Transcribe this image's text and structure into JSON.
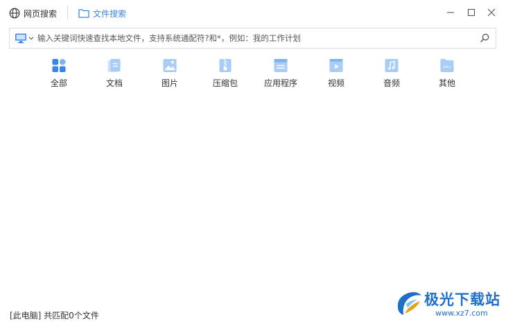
{
  "tabs": {
    "web_search": "网页搜索",
    "file_search": "文件搜索"
  },
  "window_controls": {
    "minimize": "minimize-icon",
    "maximize": "maximize-icon",
    "close": "close-icon"
  },
  "search": {
    "scope_icon": "monitor-icon",
    "placeholder": "输入关键词快速查找本地文件，支持系统通配符?和*，例如：我的工作计划",
    "value": ""
  },
  "categories": [
    {
      "label": "全部",
      "icon": "grid-icon"
    },
    {
      "label": "文档",
      "icon": "document-icon"
    },
    {
      "label": "图片",
      "icon": "image-icon"
    },
    {
      "label": "压缩包",
      "icon": "zip-icon"
    },
    {
      "label": "应用程序",
      "icon": "application-icon"
    },
    {
      "label": "视频",
      "icon": "video-icon"
    },
    {
      "label": "音频",
      "icon": "music-icon"
    },
    {
      "label": "其他",
      "icon": "folder-more-icon"
    }
  ],
  "status": {
    "text": "[此电脑] 共匹配0个文件"
  },
  "watermark": {
    "name": "极光下载站",
    "url": "www.xz7.com"
  },
  "colors": {
    "accent": "#3a86e8",
    "icon_light": "#a9cdf5",
    "icon_mid": "#7fb2ef"
  }
}
